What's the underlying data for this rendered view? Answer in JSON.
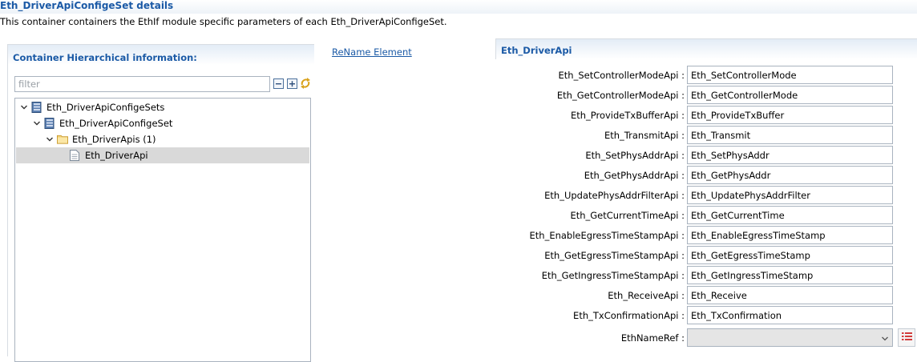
{
  "page": {
    "title": "Eth_DriverApiConfigeSet details",
    "description": "This container containers the EthIf module specific parameters of each Eth_DriverApiConfigeSet."
  },
  "left_panel": {
    "section_title": "Container Hierarchical information:",
    "filter_placeholder": "filter",
    "tree": [
      {
        "label": "Eth_DriverApiConfigeSets",
        "icon": "container-icon",
        "expanded": true
      },
      {
        "label": "Eth_DriverApiConfigeSet",
        "icon": "container-icon",
        "expanded": true
      },
      {
        "label": "Eth_DriverApis (1)",
        "icon": "folder-icon",
        "expanded": true
      },
      {
        "label": "Eth_DriverApi",
        "icon": "document-icon",
        "selected": true
      }
    ]
  },
  "rename_link": "ReName Element",
  "right_panel": {
    "section_title": "Eth_DriverApi",
    "fields": [
      {
        "label": "Eth_SetControllerModeApi :",
        "value": "Eth_SetControllerMode"
      },
      {
        "label": "Eth_GetControllerModeApi :",
        "value": "Eth_GetControllerMode"
      },
      {
        "label": "Eth_ProvideTxBufferApi :",
        "value": "Eth_ProvideTxBuffer"
      },
      {
        "label": "Eth_TransmitApi :",
        "value": "Eth_Transmit"
      },
      {
        "label": "Eth_SetPhysAddrApi :",
        "value": "Eth_SetPhysAddr"
      },
      {
        "label": "Eth_GetPhysAddrApi :",
        "value": "Eth_GetPhysAddr"
      },
      {
        "label": "Eth_UpdatePhysAddrFilterApi :",
        "value": "Eth_UpdatePhysAddrFilter"
      },
      {
        "label": "Eth_GetCurrentTimeApi :",
        "value": "Eth_GetCurrentTime"
      },
      {
        "label": "Eth_EnableEgressTimeStampApi :",
        "value": "Eth_EnableEgressTimeStamp"
      },
      {
        "label": "Eth_GetEgressTimeStampApi :",
        "value": "Eth_GetEgressTimeStamp"
      },
      {
        "label": "Eth_GetIngressTimeStampApi :",
        "value": "Eth_GetIngressTimeStamp"
      },
      {
        "label": "Eth_ReceiveApi :",
        "value": "Eth_Receive"
      },
      {
        "label": "Eth_TxConfirmationApi :",
        "value": "Eth_TxConfirmation"
      }
    ],
    "ref_field": {
      "label": "EthNameRef :",
      "value": ""
    }
  },
  "colors": {
    "accent": "#1b5aa6",
    "selection": "#d9d9d9",
    "header_gradient": "#e3ecf6"
  }
}
